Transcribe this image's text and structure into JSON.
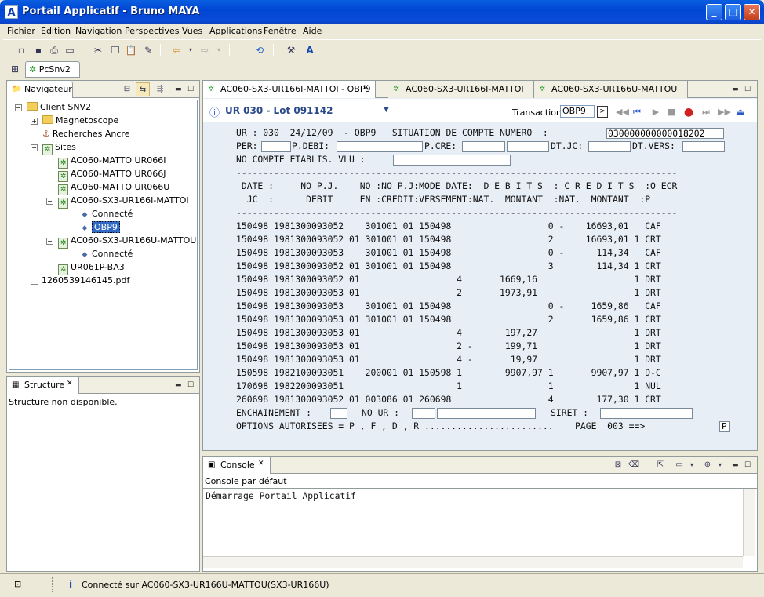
{
  "window": {
    "title": "Portail Applicatif - Bruno MAYA",
    "icon": "A",
    "btn_min": "_",
    "btn_max": "□",
    "btn_close": "✕"
  },
  "menu": [
    "Fichier",
    "Edition",
    "Navigation",
    "Perspectives",
    "Vues",
    "Applications",
    "Fenêtre",
    "Aide"
  ],
  "perspective_tab": "PcSnv2",
  "navigator": {
    "title": "Navigateur",
    "root": "Client SNV2",
    "magneto": "Magnetoscope",
    "recherches": "Recherches Ancre",
    "sites": "Sites",
    "s1": "AC060-MATTO UR066I",
    "s2": "AC060-MATTO UR066J",
    "s3": "AC060-MATTO UR066U",
    "s4": "AC060-SX3-UR166I-MATTOI",
    "connecte": "Connecté",
    "obp9": "OBP9",
    "s5": "AC060-SX3-UR166U-MATTOU",
    "s6": "UR061P-BA3",
    "pdf": "1260539146145.pdf"
  },
  "structure": {
    "title": "Structure",
    "message": "Structure non disponible."
  },
  "editor_tabs": [
    "AC060-SX3-UR166I-MATTOI - OBP9",
    "AC060-SX3-UR166I-MATTOI",
    "AC060-SX3-UR166U-MATTOU"
  ],
  "editor": {
    "header_title": "UR 030 - Lot 091142",
    "transaction_label": "Transaction",
    "transaction_value": "OBP9",
    "go": ">"
  },
  "terminal": {
    "line1": "UR : 030  24/12/09  - OBP9   SITUATION DE COMPTE NUMERO  :",
    "compte": "030000000000018202",
    "per": "PER:",
    "pdebi": "P.DEBI:",
    "pcre": "P.CRE:",
    "dtjc": "DT.JC:",
    "dtvers": "DT.VERS:",
    "nocompte": "NO COMPTE ETABLIS. VLU :",
    "sep": "----------------------------------------------------------------------------------",
    "hdr1": " DATE :     NO P.J.    NO :NO P.J:MODE DATE:  D E B I T S  : C R E D I T S  :O ECR",
    "hdr2": "  JC  :      DEBIT     EN :CREDIT:VERSEMENT:NAT.  MONTANT  :NAT.  MONTANT  :P",
    "rows": [
      "150498 1981300093052    301001 01 150498                  0 -    16693,01   CAF",
      "150498 1981300093052 01 301001 01 150498                  2      16693,01 1 CRT",
      "150498 1981300093053    301001 01 150498                  0 -      114,34   CAF",
      "150498 1981300093052 01 301001 01 150498                  3        114,34 1 CRT",
      "150498 1981300093052 01                  4       1669,16                  1 DRT",
      "150498 1981300093053 01                  2       1973,91                  1 DRT",
      "150498 1981300093053    301001 01 150498                  0 -     1659,86   CAF",
      "150498 1981300093053 01 301001 01 150498                  2       1659,86 1 CRT",
      "150498 1981300093053 01                  4        197,27                  1 DRT",
      "150498 1981300093053 01                  2 -      199,71                  1 DRT",
      "150498 1981300093053 01                  4 -       19,97                  1 DRT",
      "150598 1982100093051    200001 01 150598 1        9907,97 1       9907,97 1 D-C",
      "170698 1982200093051                     1                1               1 NUL",
      "260698 1981300093052 01 003086 01 260698                  4        177,30 1 CRT"
    ],
    "enchainement": "ENCHAINEMENT :",
    "noured": "NO UR :",
    "siret": "SIRET :",
    "options": "OPTIONS AUTORISEES = P , F , D , R ........................    PAGE  003 ==>",
    "pvalue": "P"
  },
  "console": {
    "title": "Console",
    "subtitle": "Console par défaut",
    "text": "Démarrage Portail Applicatif"
  },
  "status": {
    "text": "Connecté sur AC060-SX3-UR166U-MATTOU(SX3-UR166U)"
  }
}
